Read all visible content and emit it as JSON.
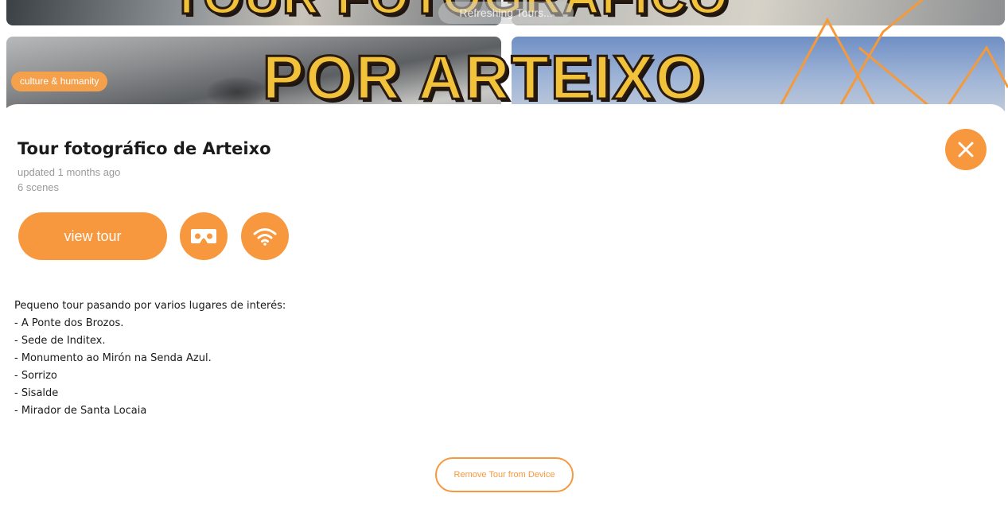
{
  "background": {
    "banner_line1": "TOUR FOTOGRÁFICO",
    "banner_line2": "POR ARTEIXO",
    "category_badge": "culture & humanity",
    "refresh_status": "Refreshing Tours..."
  },
  "sheet": {
    "title": "Tour fotográfico de Arteixo",
    "updated": "updated 1 months ago",
    "scenes": "6 scenes",
    "view_tour_label": "view tour",
    "vr_icon": "vr-headset-icon",
    "offline_icon": "wifi-icon",
    "close_icon": "close-icon",
    "description": [
      "Pequeno tour pasando por varios lugares de interés:",
      "- A Ponte dos Brozos.",
      "- Sede de Inditex.",
      "- Monumento ao Mirón na Senda Azul.",
      "- Sorrizo",
      "- Sisalde",
      "- Mirador de Santa Locaia"
    ],
    "remove_label": "Remove Tour from Device"
  },
  "colors": {
    "accent": "#f7983e",
    "badge": "#f5a04a",
    "text": "#1a1a1a",
    "muted": "#9a9a9a"
  }
}
